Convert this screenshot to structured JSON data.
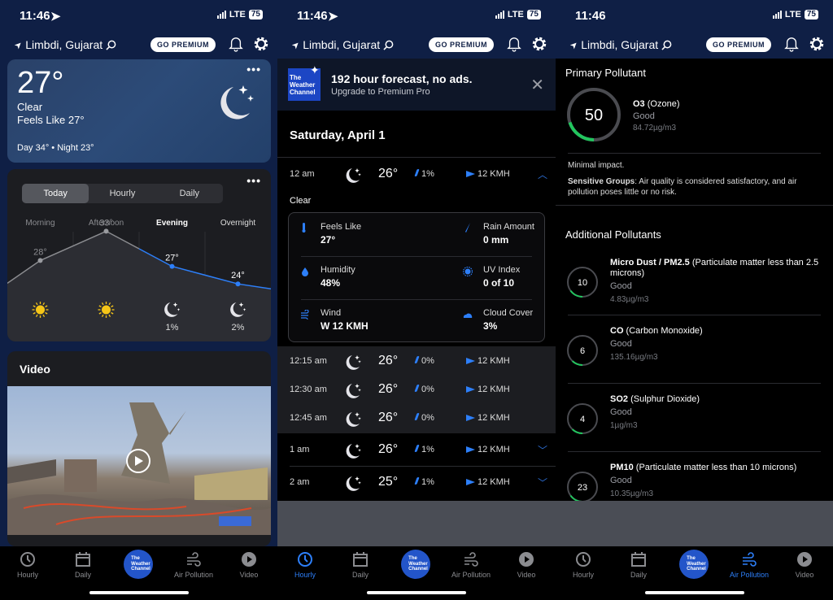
{
  "status": {
    "time": "11:46",
    "network": "LTE",
    "battery": "75"
  },
  "header": {
    "location": "Limbdi, Gujarat",
    "premium_label": "GO PREMIUM"
  },
  "nav": {
    "items": [
      {
        "label": "Hourly",
        "icon": "clock-icon"
      },
      {
        "label": "Daily",
        "icon": "calendar-icon"
      },
      {
        "label": "The Weather Channel",
        "icon": "twc-logo"
      },
      {
        "label": "Air Pollution",
        "icon": "wind-icon"
      },
      {
        "label": "Video",
        "icon": "play-icon"
      }
    ],
    "logo_lines": [
      "The",
      "Weather",
      "Channel"
    ]
  },
  "panel1": {
    "current": {
      "temp": "27°",
      "condition": "Clear",
      "feels_like": "Feels Like 27°",
      "day_night": "Day 34° • Night 23°",
      "more": "•••"
    },
    "tabs": [
      "Today",
      "Hourly",
      "Daily"
    ],
    "active_tab": "Today",
    "more": "•••",
    "periods": [
      {
        "label": "Morning",
        "temp": "28°",
        "temp_value": 28,
        "icon": "sun-icon",
        "precip": ""
      },
      {
        "label": "Afternoon",
        "temp": "33°",
        "temp_value": 33,
        "icon": "sun-icon",
        "precip": ""
      },
      {
        "label": "Evening",
        "temp": "27°",
        "temp_value": 27,
        "icon": "moon-icon",
        "precip": "1%"
      },
      {
        "label": "Overnight",
        "temp": "24°",
        "temp_value": 24,
        "icon": "moon-icon",
        "precip": "2%"
      }
    ],
    "video_heading": "Video",
    "active_nav": "none"
  },
  "panel2": {
    "promo": {
      "title": "192 hour forecast, no ads.",
      "subtitle": "Upgrade to Premium Pro",
      "logo_lines": [
        "The",
        "Weather",
        "Channel"
      ]
    },
    "day": "Saturday, April 1",
    "expanded_row": {
      "time": "12 am",
      "temp": "26°",
      "precip": "1%",
      "wind": "12 KMH",
      "condition": "Clear"
    },
    "details": [
      {
        "label": "Feels Like",
        "value": "27°",
        "icon": "thermometer-icon"
      },
      {
        "label": "Rain Amount",
        "value": "0 mm",
        "icon": "raindrop-icon"
      },
      {
        "label": "Humidity",
        "value": "48%",
        "icon": "humidity-icon"
      },
      {
        "label": "UV Index",
        "value": "0 of 10",
        "icon": "uv-icon"
      },
      {
        "label": "Wind",
        "value": "W 12 KMH",
        "icon": "wind-icon"
      },
      {
        "label": "Cloud Cover",
        "value": "3%",
        "icon": "cloud-icon"
      }
    ],
    "sub_rows": [
      {
        "time": "12:15 am",
        "temp": "26°",
        "precip": "0%",
        "wind": "12 KMH"
      },
      {
        "time": "12:30 am",
        "temp": "26°",
        "precip": "0%",
        "wind": "12 KMH"
      },
      {
        "time": "12:45 am",
        "temp": "26°",
        "precip": "0%",
        "wind": "12 KMH"
      }
    ],
    "rows": [
      {
        "time": "1 am",
        "temp": "26°",
        "precip": "1%",
        "wind": "12 KMH"
      },
      {
        "time": "2 am",
        "temp": "25°",
        "precip": "1%",
        "wind": "12 KMH"
      }
    ],
    "active_nav": "Hourly"
  },
  "panel3": {
    "primary_heading": "Primary Pollutant",
    "primary": {
      "value": "50",
      "name": "O3",
      "desc": " (Ozone)",
      "status": "Good",
      "concentration": "84.72µg/m3",
      "ring_fraction": 0.2
    },
    "impact": "Minimal impact.",
    "sensitive_label": "Sensitive Groups",
    "sensitive_text": ": Air quality is considered satisfactory, and air pollution poses little or no risk.",
    "additional_heading": "Additional Pollutants",
    "pollutants": [
      {
        "value": "10",
        "name": "Micro Dust / PM2.5",
        "desc": " (Particulate matter less than 2.5 microns)",
        "status": "Good",
        "concentration": "4.83µg/m3",
        "ring_fraction": 0.15
      },
      {
        "value": "6",
        "name": "CO",
        "desc": " (Carbon Monoxide)",
        "status": "Good",
        "concentration": "135.16µg/m3",
        "ring_fraction": 0.12
      },
      {
        "value": "4",
        "name": "SO2",
        "desc": " (Sulphur Dioxide)",
        "status": "Good",
        "concentration": "1µg/m3",
        "ring_fraction": 0.12
      },
      {
        "value": "23",
        "name": "PM10",
        "desc": " (Particulate matter less than 10 microns)",
        "status": "Good",
        "concentration": "10.35µg/m3",
        "ring_fraction": 0.15
      }
    ],
    "active_nav": "Air Pollution"
  },
  "colors": {
    "accent": "#2d7ff9",
    "good": "#22c55e",
    "navy": "#0f1f45",
    "twc_blue": "#2355c9"
  }
}
